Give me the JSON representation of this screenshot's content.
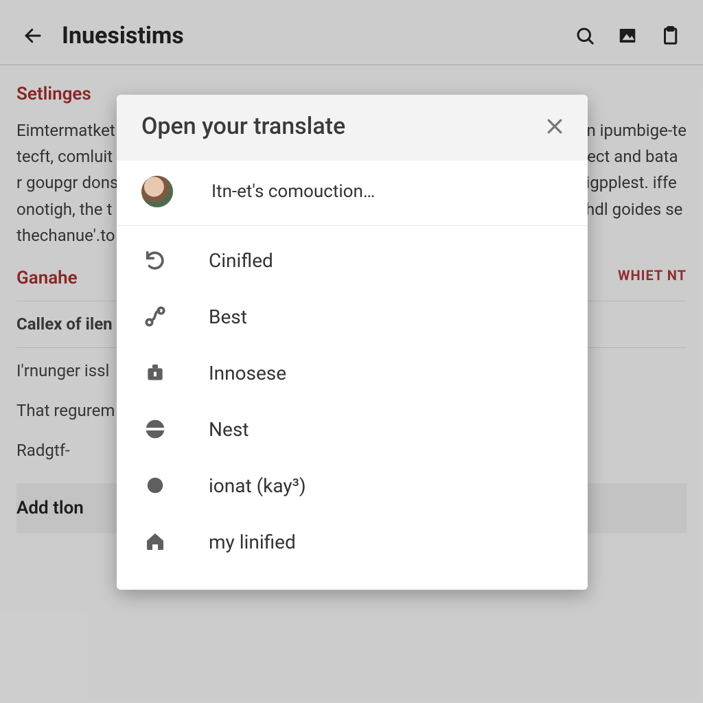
{
  "appbar": {
    "title": "Inuesistims"
  },
  "background": {
    "section1_title": "Setlinges",
    "paragraph_left": "Eimtermatket\ntecft, comluit\nr goupgr dons\nonotigh, the t\nthechanue'.to",
    "paragraph_right": "e on ipumbige-te\noidect and bata\nt; sigpplest. iffe\neishdl goides se",
    "section2_title": "Ganahe",
    "right_flag": "WHIET NT",
    "row_title": "Callex of ilen",
    "list": [
      "I'rnunger issl",
      "That regurem",
      "Radgtf-"
    ],
    "add_label": "Add tlon"
  },
  "modal": {
    "title": "Open your translate",
    "account_text": "Itn-et's comouction…",
    "options": [
      {
        "icon": "undo-icon",
        "label": "Cinifled"
      },
      {
        "icon": "route-icon",
        "label": "Best"
      },
      {
        "icon": "case-icon",
        "label": "Innosese"
      },
      {
        "icon": "split-icon",
        "label": "Nest"
      },
      {
        "icon": "dot-icon",
        "label": "ionat (kay³)"
      },
      {
        "icon": "home-icon",
        "label": "my linified"
      }
    ]
  }
}
